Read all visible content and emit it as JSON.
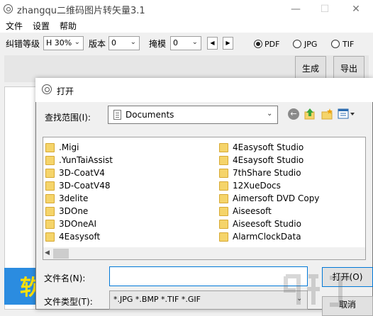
{
  "app": {
    "title": "zhangqu二维码图片转矢量3.1",
    "window_controls": {
      "minimize": "—",
      "maximize": "☐",
      "close": "✕"
    }
  },
  "menu": {
    "items": [
      "文件",
      "设置",
      "帮助"
    ]
  },
  "toolbar": {
    "ecc_label": "纠错等级",
    "ecc_value": "H 30%",
    "version_label": "版本",
    "version_value": "0",
    "mask_label": "掩模",
    "mask_value": "0",
    "formats": [
      {
        "label": "PDF",
        "selected": true
      },
      {
        "label": "JPG",
        "selected": false
      },
      {
        "label": "TIF",
        "selected": false
      }
    ]
  },
  "actions": {
    "generate_label": "生成",
    "export_label": "导出"
  },
  "promo": {
    "text": "软"
  },
  "dialog": {
    "title": "打开",
    "lookin_label": "查找范围(I):",
    "lookin_value": "Documents",
    "folders_left": [
      ".Migi",
      ".YunTaiAssist",
      "3D-CoatV4",
      "3D-CoatV48",
      "3delite",
      "3DOne",
      "3DOneAI",
      "4Easysoft"
    ],
    "folders_right": [
      "4Easysoft Studio",
      "4Esaysoft Studio",
      "7thShare Studio",
      "12XueDocs",
      "Aimersoft DVD Copy",
      "Aiseesoft",
      "Aiseesoft Studio",
      "AlarmClockData"
    ],
    "filename_label": "文件名(N):",
    "filename_value": "",
    "filetype_label": "文件类型(T):",
    "filetype_value": "*.JPG *.BMP *.TIF *.GIF",
    "open_label": "打开(O)",
    "cancel_label": "取消"
  },
  "colors": {
    "accent": "#0078d7",
    "folder": "#f5d46a",
    "promo_bg": "#2b8ce0",
    "promo_text": "#ffe000"
  }
}
